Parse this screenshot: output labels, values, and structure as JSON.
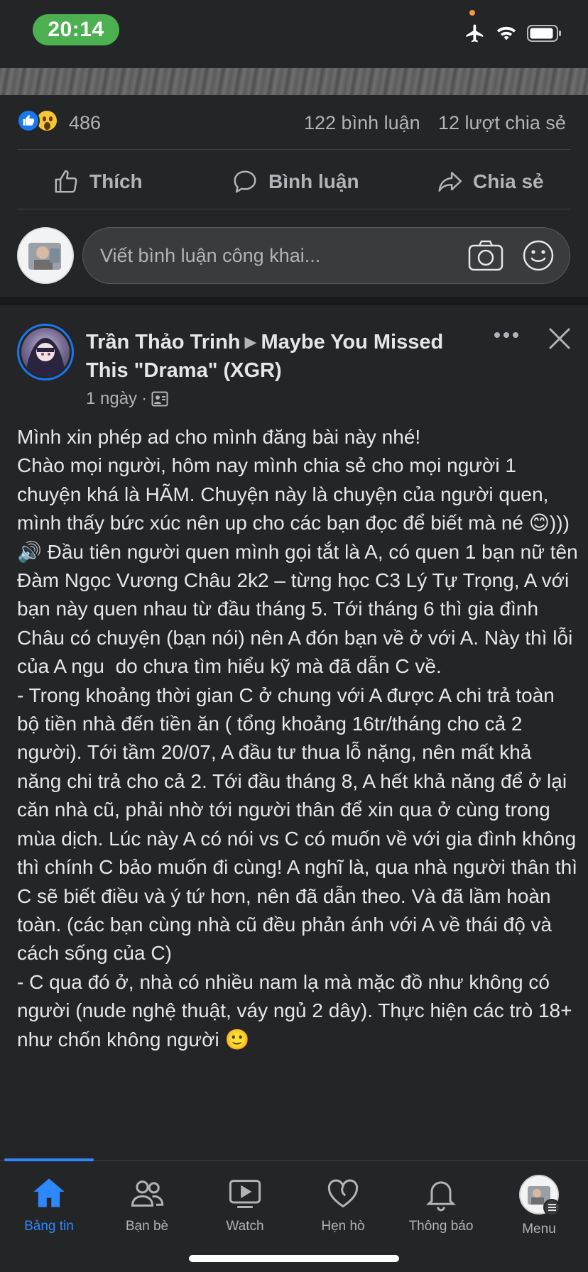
{
  "status_bar": {
    "time": "20:14"
  },
  "reactions": {
    "count": "486",
    "comments": "122 bình luận",
    "shares": "12 lượt chia sẻ"
  },
  "actions": {
    "like": "Thích",
    "comment": "Bình luận",
    "share": "Chia sẻ"
  },
  "composer": {
    "placeholder": "Viết bình luận công khai..."
  },
  "post": {
    "author": "Trần Thảo Trinh",
    "group": "Maybe You Missed This \"Drama\" (XGR)",
    "time": "1 ngày",
    "body": "Mình xin phép ad cho mình đăng bài này nhé!\nChào mọi người, hôm nay mình chia sẻ cho mọi người 1 chuyện khá là HÃM. Chuyện này là chuyện của người quen, mình thấy bức xúc nên up cho các bạn đọc để biết mà né 😊)))\n🔊 Đầu tiên người quen mình gọi tắt là A, có quen 1 bạn nữ tên Đàm Ngọc Vương Châu 2k2 – từng học C3 Lý Tự Trọng, A với bạn này quen nhau từ đầu tháng 5. Tới tháng 6 thì gia đình Châu có chuyện (bạn nói) nên A đón bạn về ở với A. Này thì lỗi của A ngu  do chưa tìm hiểu kỹ mà đã dẫn C về.\n- Trong khoảng thời gian C ở chung với A được A chi trả toàn bộ tiền nhà đến tiền ăn ( tổng khoảng 16tr/tháng cho cả 2 người). Tới tầm 20/07, A đầu tư thua lỗ nặng, nên mất khả năng chi trả cho cả 2. Tới đầu tháng 8, A hết khả năng để ở lại căn nhà cũ, phải nhờ tới người thân để xin qua ở cùng trong mùa dịch. Lúc này A có nói vs C có muốn về với gia đình không thì chính C bảo muốn đi cùng! A nghĩ là, qua nhà người thân thì C sẽ biết điều và ý tứ hơn, nên đã dẫn theo. Và đã lầm hoàn toàn. (các bạn cùng nhà cũ đều phản ánh với A về thái độ và cách sống của C)\n- C qua đó ở, nhà có nhiều nam lạ mà mặc đồ như không có người (nude nghệ thuật, váy ngủ 2 dây). Thực hiện các trò 18+ như chốn không người 🙂"
  },
  "nav": {
    "items": [
      {
        "label": "Bảng tin",
        "icon": "home-icon",
        "active": true
      },
      {
        "label": "Bạn bè",
        "icon": "friends-icon"
      },
      {
        "label": "Watch",
        "icon": "watch-icon"
      },
      {
        "label": "Hẹn hò",
        "icon": "dating-icon"
      },
      {
        "label": "Thông báo",
        "icon": "bell-icon"
      },
      {
        "label": "Menu",
        "icon": "menu-icon"
      }
    ],
    "active_color": "#2d88ff"
  },
  "colors": {
    "background": "#242526",
    "text": "#e4e6eb",
    "secondary": "#b0b3b8",
    "accent": "#1877f2",
    "time_pill": "#4cb050"
  }
}
